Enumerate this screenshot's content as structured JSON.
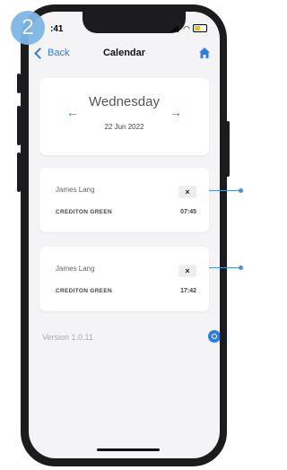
{
  "step_badge": "2",
  "status_bar": {
    "time": ":41"
  },
  "nav": {
    "back_label": "Back",
    "title": "Calendar",
    "home_icon": "home-icon"
  },
  "date_selector": {
    "day": "Wednesday",
    "date": "22 Jun 2022",
    "prev_icon": "arrow-left-icon",
    "next_icon": "arrow-right-icon"
  },
  "entries": [
    {
      "name": "James Lang",
      "location": "CREDITON GREEN",
      "time": "07:45",
      "remove_label": "×"
    },
    {
      "name": "James Lang",
      "location": "CREDITON GREEN",
      "time": "17:42",
      "remove_label": "×"
    }
  ],
  "footer": {
    "version": "Version 1.0.11",
    "settings_icon": "settings-icon"
  },
  "colors": {
    "accent": "#2f7de1",
    "badge": "#7fb6e6",
    "background": "#f4f4f6"
  }
}
